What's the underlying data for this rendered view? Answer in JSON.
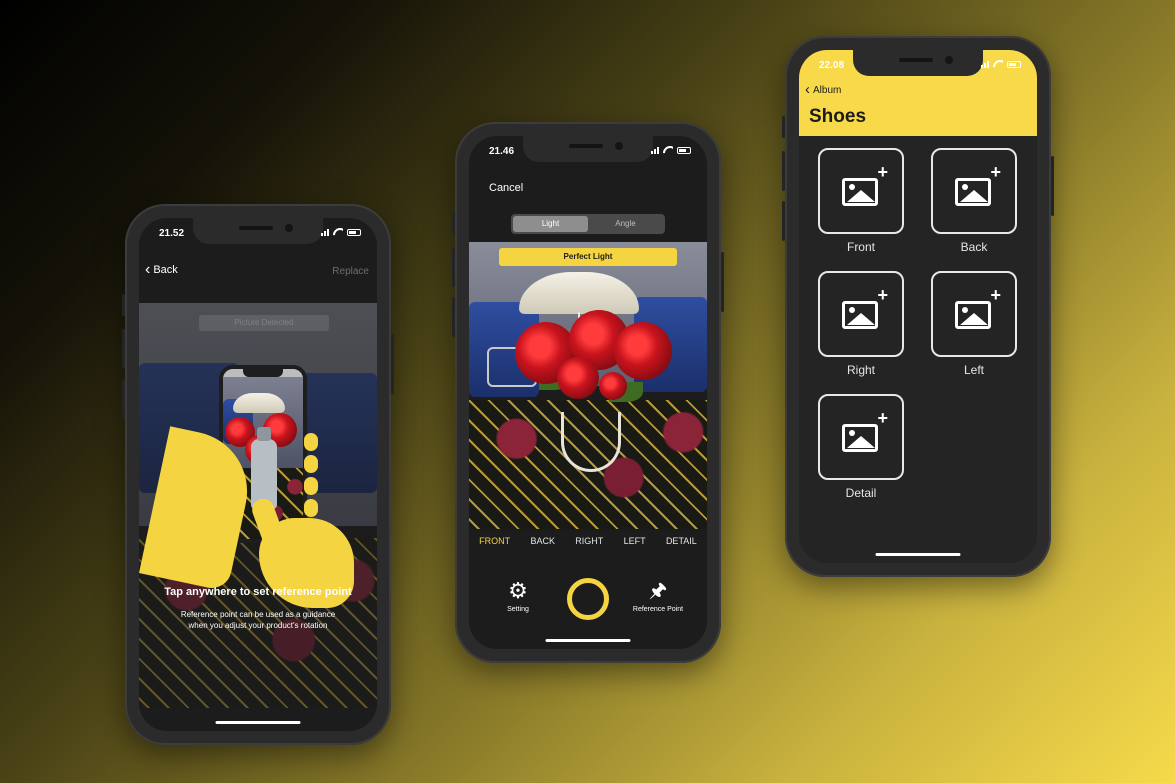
{
  "phone1": {
    "time": "21.52",
    "back_label": "Back",
    "replace_label": "Replace",
    "faded_label": "Picture Detected",
    "hint_title": "Tap anywhere to set reference point",
    "hint_body_line1": "Reference point can be used as a guidance",
    "hint_body_line2": "when you adjust your product's rotation"
  },
  "phone2": {
    "time": "21.46",
    "cancel_label": "Cancel",
    "segments": [
      "Light",
      "Angle"
    ],
    "active_segment": "Light",
    "banner": "Perfect Light",
    "angles": [
      "FRONT",
      "BACK",
      "RIGHT",
      "LEFT",
      "DETAIL"
    ],
    "active_angle": "FRONT",
    "setting_label": "Setting",
    "reference_label": "Reference Point"
  },
  "phone3": {
    "time": "22.08",
    "back_label": "Album",
    "title": "Shoes",
    "tiles": [
      "Front",
      "Back",
      "Right",
      "Left",
      "Detail"
    ]
  },
  "colors": {
    "accent_yellow": "#F5D442",
    "phone_body": "#2B2B2B",
    "screen_dark": "#1C1C1C"
  },
  "icons": [
    "chevron-left-icon",
    "gear-icon",
    "pin-icon",
    "image-add-icon",
    "signal-icon",
    "wifi-icon",
    "battery-icon"
  ]
}
